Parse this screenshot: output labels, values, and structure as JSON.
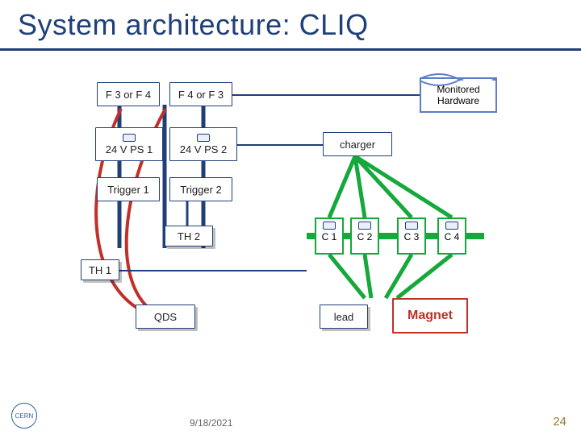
{
  "title": "System architecture: CLIQ",
  "footer": {
    "date": "9/18/2021",
    "page": "24",
    "logo_text": "CERN"
  },
  "nodes": {
    "f3f4": "F 3 or F 4",
    "f4f3": "F 4 or F 3",
    "ps1": "24 V PS 1",
    "ps2": "24 V PS 2",
    "trg1": "Trigger 1",
    "trg2": "Trigger 2",
    "th1": "TH 1",
    "th2": "TH 2",
    "qds": "QDS",
    "charger": "charger",
    "c1": "C 1",
    "c2": "C 2",
    "c3": "C 3",
    "c4": "C 4",
    "lead": "lead",
    "magnet": "Magnet",
    "monitored": "Monitored\nHardware"
  }
}
